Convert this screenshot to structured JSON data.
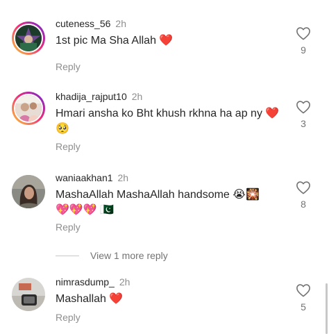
{
  "comments": [
    {
      "username": "cuteness_56",
      "time": "2h",
      "text": "1st pic Ma Sha Allah ❤️",
      "reply_label": "Reply",
      "likes": "9",
      "avatar_ring": true
    },
    {
      "username": "khadija_rajput10",
      "time": "2h",
      "text": "Hmari ansha ko Bht khush rkhna ha ap ny ❤️🥺",
      "reply_label": "Reply",
      "likes": "3",
      "avatar_ring": true
    },
    {
      "username": "waniaakhan1",
      "time": "2h",
      "text": "MashaAllah MashaAllah handsome 😭🎇 💖💖💖 🇵🇰",
      "reply_label": "Reply",
      "likes": "8",
      "avatar_ring": false
    },
    {
      "username": "nimrasdump_",
      "time": "2h",
      "text": "Mashallah ❤️",
      "reply_label": "Reply",
      "likes": "5",
      "avatar_ring": false
    }
  ],
  "view_more_replies": "View 1 more reply",
  "icons": {
    "like": "heart-outline-icon"
  },
  "colors": {
    "primary_text": "#262626",
    "secondary_text": "#8e8e8e",
    "story_ring_start": "#f9ce34",
    "story_ring_end": "#6228d7"
  }
}
